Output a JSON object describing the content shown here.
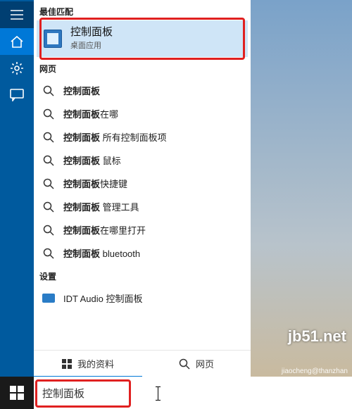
{
  "sections": {
    "best": "最佳匹配",
    "web": "网页",
    "settings": "设置"
  },
  "best": {
    "title": "控制面板",
    "sub": "桌面应用"
  },
  "web": [
    {
      "parts": [
        "控制面板",
        ""
      ]
    },
    {
      "parts": [
        "控制面板",
        "在哪"
      ]
    },
    {
      "parts": [
        "控制面板",
        " 所有控制面板项"
      ]
    },
    {
      "parts": [
        "控制面板",
        " 鼠标"
      ]
    },
    {
      "parts": [
        "控制面板",
        "快捷键"
      ]
    },
    {
      "parts": [
        "控制面板",
        " 管理工具"
      ]
    },
    {
      "parts": [
        "控制面板",
        "在哪里打开"
      ]
    },
    {
      "parts": [
        "控制面板",
        " bluetooth"
      ]
    }
  ],
  "settings": [
    {
      "label": "IDT Audio 控制面板"
    }
  ],
  "tabs": {
    "mine": "我的资料",
    "web": "网页"
  },
  "search": {
    "value": "控制面板"
  },
  "watermark": {
    "big": "jb51.net",
    "small": "jiaocheng@thanzhan"
  }
}
